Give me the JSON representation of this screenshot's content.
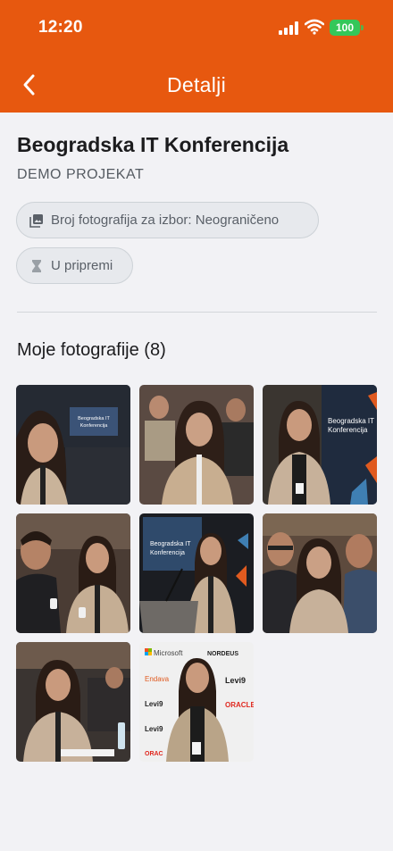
{
  "status_bar": {
    "time": "12:20",
    "battery": "100"
  },
  "header": {
    "title": "Detalji"
  },
  "project": {
    "name": "Beogradska IT Konferencija",
    "subtitle": "DEMO PROJEKAT"
  },
  "chips": {
    "photo_limit": "Broj fotografija za izbor: Neograničeno",
    "status": "U pripremi"
  },
  "gallery": {
    "title": "Moje fotografije (8)",
    "photos": [
      {
        "screen_text": [
          "Beogradska IT",
          "Konferencija"
        ]
      },
      {
        "screen_text": []
      },
      {
        "screen_text": [
          "Beogradska IT",
          "Konferencija"
        ]
      },
      {
        "screen_text": []
      },
      {
        "screen_text": [
          "Beogradska IT",
          "Konferencija"
        ]
      },
      {
        "screen_text": []
      },
      {
        "screen_text": []
      },
      {
        "sponsors": [
          "Microsoft",
          "NORDEUS",
          "Endava",
          "Levi9",
          "Levi9",
          "ORACLE",
          "Levi9",
          "ORAC"
        ]
      }
    ]
  },
  "colors": {
    "accent": "#e7580f",
    "battery": "#34c759"
  }
}
